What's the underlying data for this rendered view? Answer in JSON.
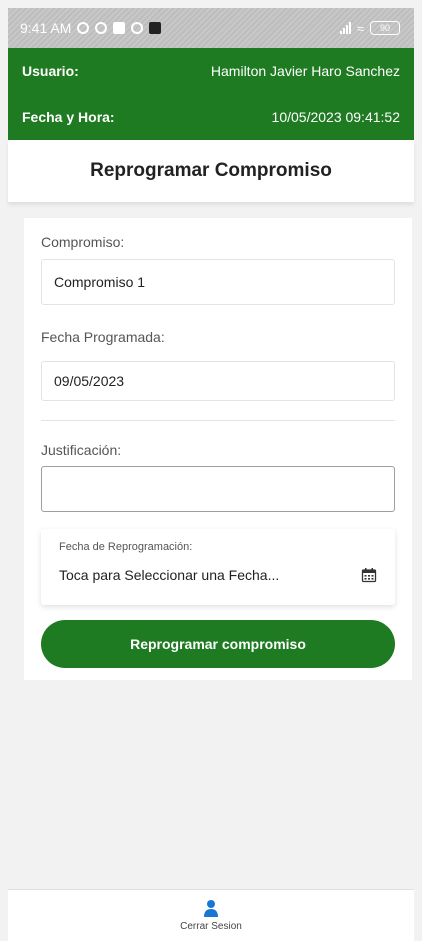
{
  "status_bar": {
    "time": "9:41 AM",
    "battery": "90"
  },
  "header": {
    "user_label": "Usuario:",
    "user_value": "Hamilton Javier Haro Sanchez",
    "datetime_label": "Fecha y Hora:",
    "datetime_value": "10/05/2023 09:41:52"
  },
  "page": {
    "title": "Reprogramar Compromiso"
  },
  "form": {
    "compromiso_label": "Compromiso:",
    "compromiso_value": "Compromiso 1",
    "fecha_programada_label": "Fecha Programada:",
    "fecha_programada_value": "09/05/2023",
    "justificacion_label": "Justificación:",
    "justificacion_value": "",
    "reprogramacion_label": "Fecha de Reprogramación:",
    "reprogramacion_placeholder": "Toca para Seleccionar una Fecha...",
    "submit_label": "Reprogramar compromiso"
  },
  "bottom_nav": {
    "logout_label": "Cerrar Sesion",
    "logout_icon": "user-icon"
  },
  "colors": {
    "primary_green": "#1e7b21",
    "accent_blue": "#1976d2"
  }
}
